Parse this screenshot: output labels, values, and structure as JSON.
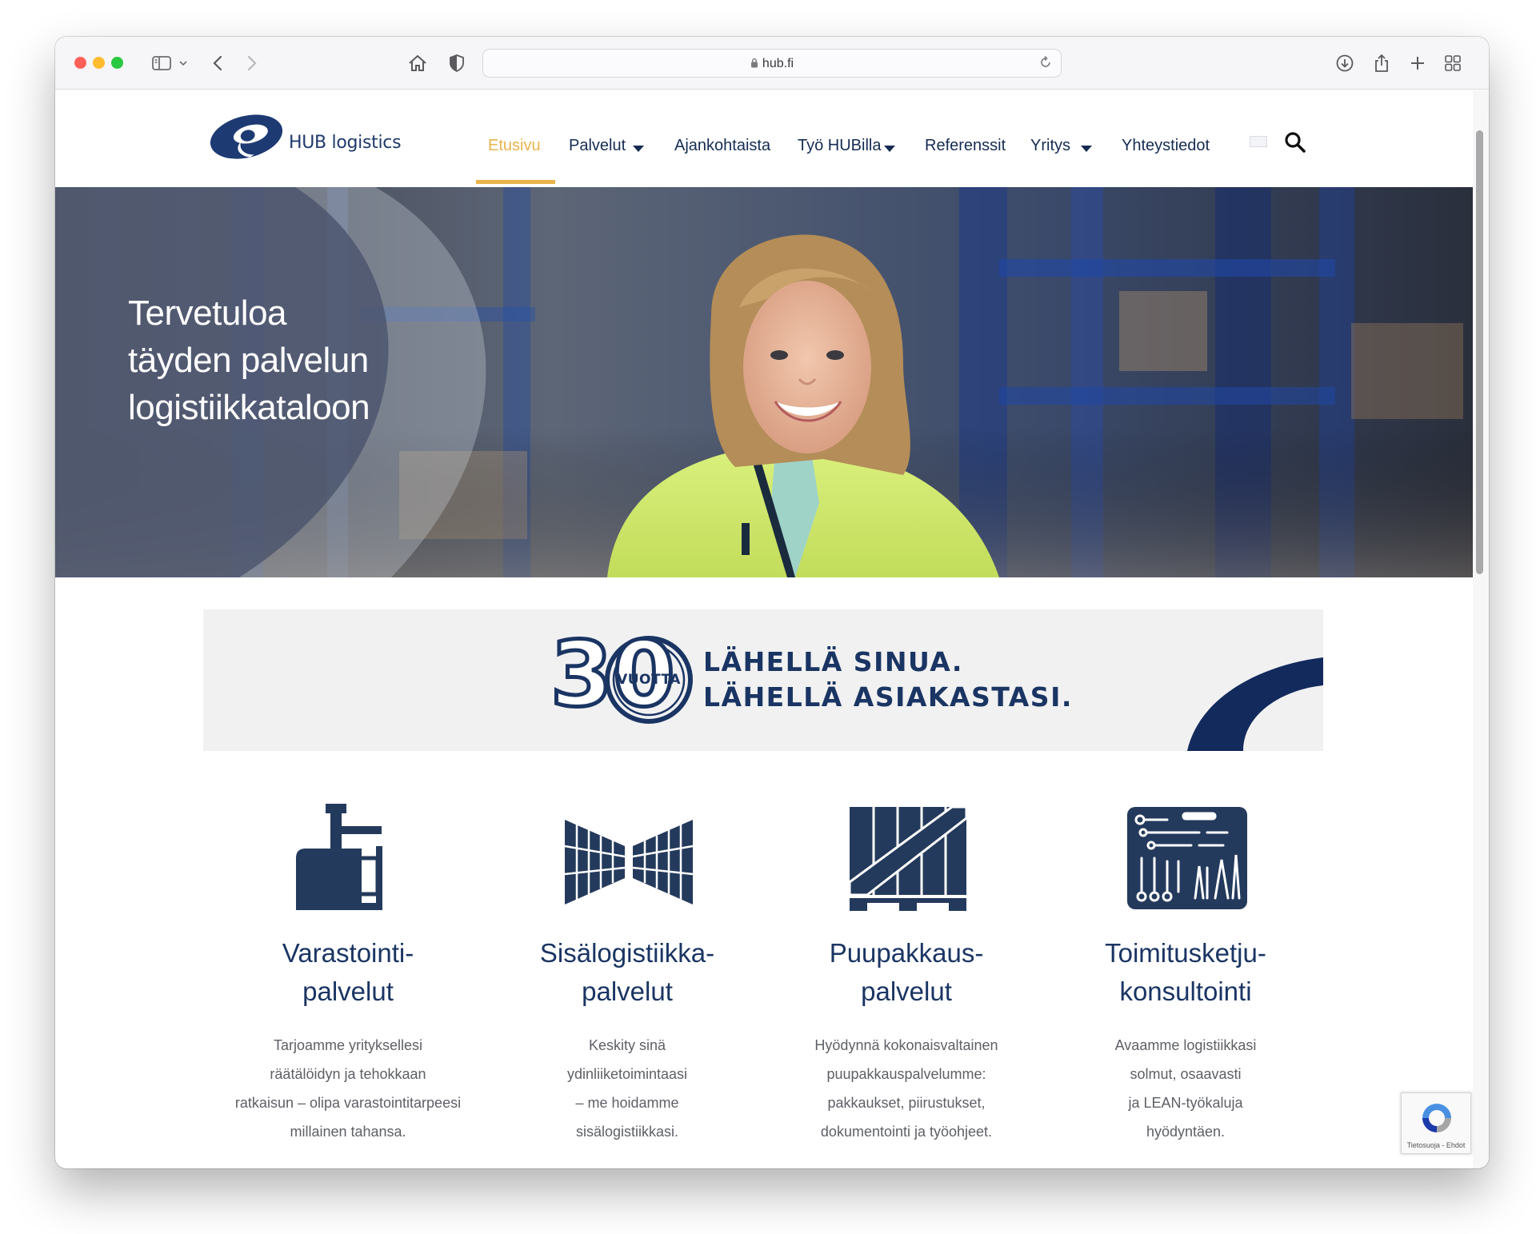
{
  "browser": {
    "url": "hub.fi"
  },
  "site": {
    "logo_text": "HUB logistics",
    "nav": [
      {
        "label": "Etusivu",
        "active": true
      },
      {
        "label": "Palvelut",
        "dropdown": true
      },
      {
        "label": "Ajankohtaista"
      },
      {
        "label": "Työ HUBilla",
        "dropdown": true
      },
      {
        "label": "Referenssit"
      },
      {
        "label": "Yritys",
        "dropdown": true
      },
      {
        "label": "Yhteystiedot"
      }
    ]
  },
  "hero": {
    "title_lines": [
      "Tervetuloa",
      "täyden palvelun",
      "logistiikkataloon"
    ]
  },
  "banner": {
    "number": "30",
    "badge_text": "VUOTTA",
    "line1": "LÄHELLÄ SINUA.",
    "line2": "LÄHELLÄ ASIAKASTASI."
  },
  "services": [
    {
      "icon": "reach-truck-icon",
      "title": [
        "Varastointi-",
        "palvelut"
      ],
      "desc": [
        "Tarjoamme yrityksellesi",
        "räätälöidyn ja tehokkaan",
        "ratkaisun – olipa varastointitarpeesi",
        "millainen tahansa."
      ]
    },
    {
      "icon": "warehouse-shelves-icon",
      "title": [
        "Sisälogistiikka-",
        "palvelut"
      ],
      "desc": [
        "Keskity sinä",
        "ydinliiketoimintaasi",
        "– me hoidamme",
        "sisälogistiikkasi."
      ]
    },
    {
      "icon": "wooden-crate-icon",
      "title": [
        "Puupakkaus-",
        "palvelut"
      ],
      "desc": [
        "Hyödynnä kokonaisvaltainen",
        "puupakkauspalvelumme:",
        "pakkaukset, piirustukset,",
        "dokumentointi ja työohjeet."
      ]
    },
    {
      "icon": "toolbox-icon",
      "title": [
        "Toimitusketju-",
        "konsultointi"
      ],
      "desc": [
        "Avaamme logistiikkasi",
        "solmut, osaavasti",
        "ja LEAN-työkaluja",
        "hyödyntäen."
      ]
    }
  ],
  "recaptcha": {
    "text": "Tietosuoja - Ehdot"
  },
  "colors": {
    "brand_navy": "#1a3563",
    "accent_gold": "#e8b44b",
    "banner_bg": "#f1f1f2"
  }
}
